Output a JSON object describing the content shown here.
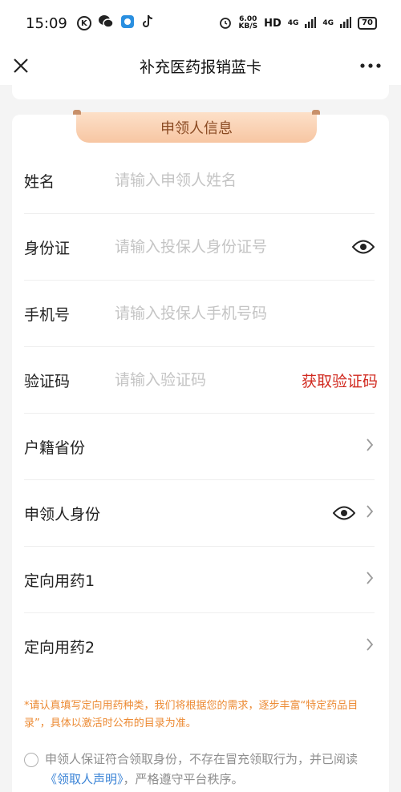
{
  "status_bar": {
    "time": "15:09",
    "app_k": "K",
    "net_speed_value": "6.00",
    "net_speed_unit": "KB/S",
    "hd": "HD",
    "net_4g_a": "4G",
    "net_4g_b": "4G",
    "battery": "70"
  },
  "header": {
    "title": "补充医药报销蓝卡"
  },
  "section": {
    "title": "申领人信息"
  },
  "form": {
    "rows": [
      {
        "label": "姓名",
        "placeholder": "请输入申领人姓名"
      },
      {
        "label": "身份证",
        "placeholder": "请输入投保人身份证号"
      },
      {
        "label": "手机号",
        "placeholder": "请输入投保人手机号码"
      },
      {
        "label": "验证码",
        "placeholder": "请输入验证码",
        "action": "获取验证码"
      },
      {
        "label": "户籍省份"
      },
      {
        "label": "申领人身份"
      },
      {
        "label": "定向用药1"
      },
      {
        "label": "定向用药2"
      }
    ]
  },
  "notice": "*请认真填写定向用药种类，我们将根据您的需求，逐步丰富“特定药品目录”，具体以激活时公布的目录为准。",
  "agreement": {
    "text_before": "申领人保证符合领取身份，不存在冒充领取行为，并已阅读",
    "link": "《领取人声明》",
    "text_after": "，严格遵守平台秩序。"
  },
  "colors": {
    "accent_red": "#d12a20",
    "notice_orange": "#ec8a33",
    "link_blue": "#3a83d6",
    "ribbon": "#f7c6a3"
  },
  "icons": {
    "close": "close-icon",
    "more": "more-dots-icon",
    "eye": "eye-icon",
    "chevron": "chevron-right-icon"
  }
}
